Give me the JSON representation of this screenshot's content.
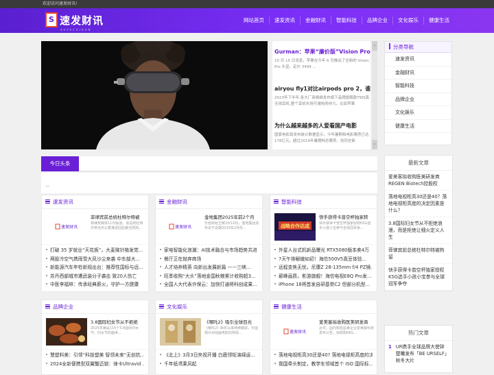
{
  "topbar": {
    "welcome": "欢迎访问速发财讯!"
  },
  "logo": {
    "mark": "S",
    "text": "速发财讯",
    "sub": "SUFACAIXUN"
  },
  "nav": [
    "网站首页",
    "速发资讯",
    "金融财讯",
    "智能科技",
    "品牌企业",
    "文化娱乐",
    "健康生活"
  ],
  "headlines": [
    {
      "title": "Gurman：苹果“廉价版”Vision Pro",
      "desc": "10 月 15 日消息，苹果在今年 6 月推出了全新的 Vision Pro 头显，定价 3499 ..."
    },
    {
      "title": "airyou fly1对比airpods pro 2，谁才是",
      "desc": "2023年下半年,各大厂商相继发布旗下品牌旗舰款TWS真无线耳机,整个耳机市场可谓热闹非凡。比如苹果"
    },
    {
      "title": "为什么越来越多的人爱看国产电影",
      "desc": "国家电影局发布统计数据显示，今年暑期档电影票房已达178亿元，超过2019年暑期档总票房，创历史新"
    }
  ],
  "category_nav": {
    "title": "分类导航",
    "items": [
      "速发资讯",
      "金融财讯",
      "智能科技",
      "品牌企业",
      "文化娱乐",
      "健康生活"
    ]
  },
  "today": {
    "tab": "今日头条"
  },
  "sections": [
    {
      "title": "速发资讯",
      "top_title": "菲律宾前总统杜特尔特被",
      "top_desc": "菲律宾媒体11日报道，前总统杜特尔特当天从香港返回后被当局拘...",
      "thumb": "速发财讯",
      "list": [
        "打破 35 岁就业“天花板”，大麦微针植发党...",
        "两股冷空气携雨雪大风沙尘来袭 中东部大...",
        "新能源汽车年检新规出台：推荐性国标与远...",
        "苏丹西部城市遭武装分子袭击 致20人伤亡",
        "中医李福林：传承经典薪火，守护一方健康"
      ]
    },
    {
      "title": "金融财讯",
      "top_title": "金地集团2025年前2个月",
      "top_desc": "乐居财经王敏3月10日，金地集团发布关于近期2025年2月份...",
      "thumb": "速发财讯",
      "list": [
        "家电智能化浪潮：AI技术融合与市场趋势共进",
        "餐厅正在抛弃商场",
        "人才培养精英 向新出发展新篇 ——三峡...",
        "旺季收购“大头”落地金国秋粮累计收购超3...",
        "全国人大代表许保云：加快打通将科创成果..."
      ]
    },
    {
      "title": "智能科技",
      "top_title": "快手获得卡普空杯独家转",
      "top_desc": "快手获得卡普空杯独家授权KSG选手小孩小宝参与全球冠军争...",
      "thumb": "战略合作达成",
      "list": [
        "外星人台式机新品曝光 RTX5080版本卖4万",
        "7天午排解撤如初！海信500V5真豆体验...",
        "远程变焦无忧，尼康Z 28-135mm f/4 PZ镜...",
        "巅峰画质，影游旗舰！海信电视E8Q Pro发...",
        "iPhone 18将首发自研基带C2 但部分机型..."
      ]
    },
    {
      "title": "品牌企业",
      "top_title": "3.8国际妇女节从不拒绝",
      "top_desc": "2025年第是115个3.8国际妇女节。妇女节的面世...",
      "thumb": "",
      "list": [
        "慧塑料美：引领“科技塑美 智领未来”无创抗...",
        "2024全新便携型双翼蟹迈锁：徕卡Ultravid ..."
      ]
    },
    {
      "title": "文化娱乐",
      "top_title": "《哪吒2》吸引全球目光",
      "top_desc": "《哪吒2》新年以来持续霸屏，中国观众对动画电影的热情...",
      "thumb": "",
      "list": [
        "《北上》3月3日央视开播 白鹿领衔演绎运...",
        "千年纸鸢乘风起"
      ]
    },
    {
      "title": "健康生活",
      "top_title": "爱美客拟收购医美研发商",
      "top_desc": "近日，国内知名医美企业爱美客科技发布公告，拟收购REG...",
      "thumb": "速发财讯",
      "list": [
        "落地电视柜高30还是40? 落地电视柜高度的决...",
        "我国牵头制定，教学车领域首个 ISO 国际标..."
      ]
    }
  ],
  "latest": {
    "title": "最新文章",
    "items": [
      "爱美客拟收购医美研发商REGEN Biotech控股权",
      "落地电视柜高30还是40？落地电视柜高度的决定因素是什么？",
      "3.8国际妇女节从不拒绝浪漫，而是拒绝让细火定义人生",
      "菲律宾前总统杜特尔特被拘留",
      "快手获得卡普空杯独家授权KSG选手小孩小宝参与全球冠军争夺"
    ]
  },
  "hot": {
    "title": "热门文章",
    "items": [
      {
        "num": "1",
        "text": "UR携手全球品牌大使钟楚曦发布「BE URSELF」秋冬大片"
      }
    ]
  }
}
